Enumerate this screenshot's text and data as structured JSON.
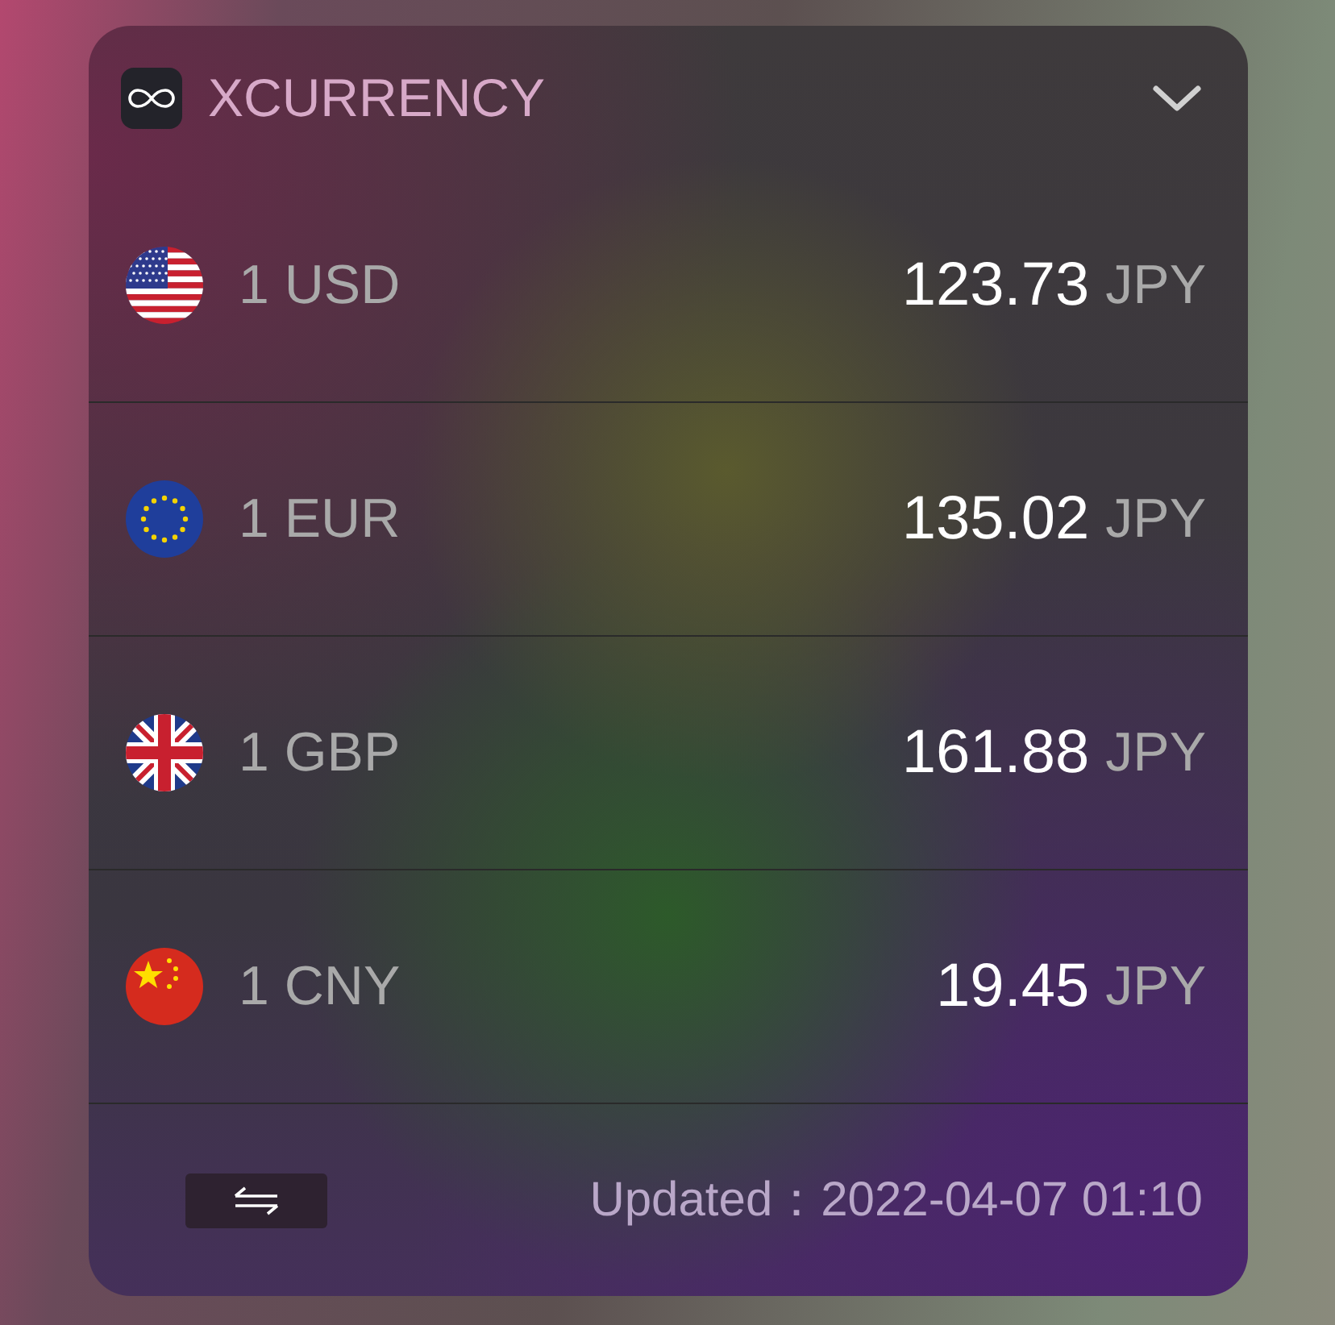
{
  "widget": {
    "title": "XCURRENCY",
    "expanded": false
  },
  "rates": [
    {
      "kind": "us",
      "base": "1 USD",
      "amount": "123.73",
      "target": "JPY"
    },
    {
      "kind": "eu",
      "base": "1 EUR",
      "amount": "135.02",
      "target": "JPY"
    },
    {
      "kind": "gb",
      "base": "1 GBP",
      "amount": "161.88",
      "target": "JPY"
    },
    {
      "kind": "cn",
      "base": "1 CNY",
      "amount": "19.45",
      "target": "JPY"
    }
  ],
  "footer": {
    "updated": "Updated：2022-04-07 01:10"
  }
}
